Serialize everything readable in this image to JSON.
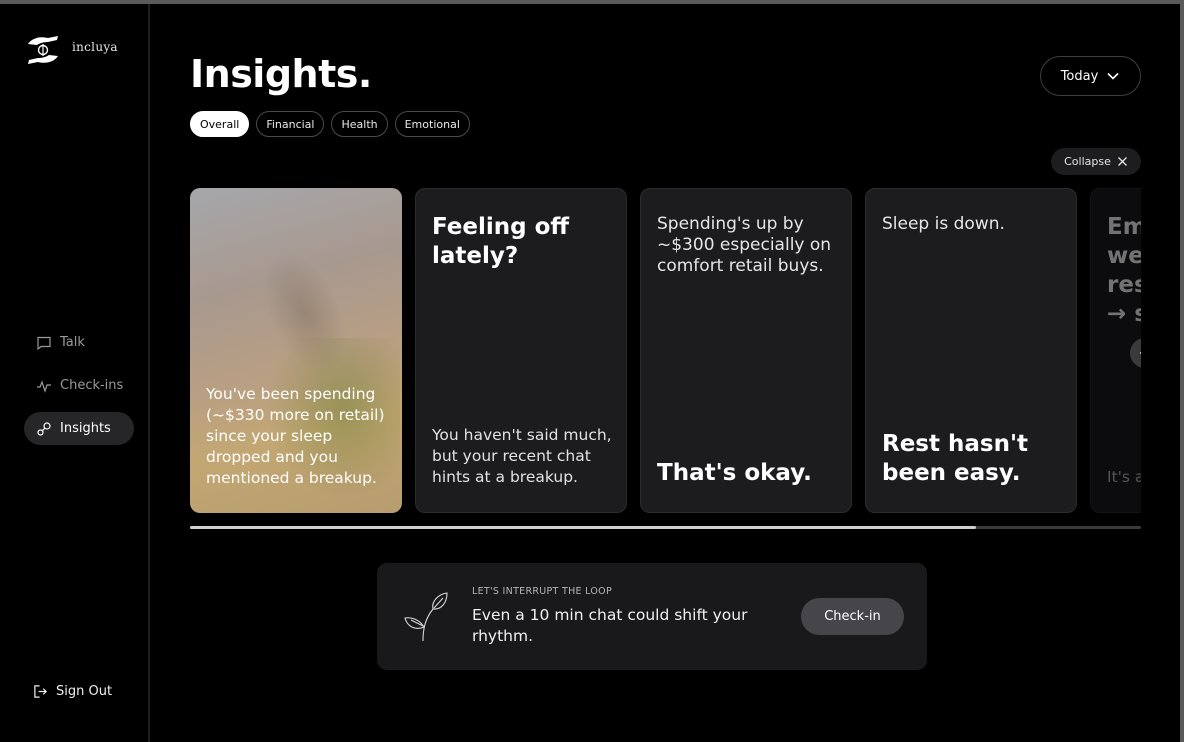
{
  "app": {
    "brand": "incluya"
  },
  "sidebar": {
    "items": [
      {
        "label": "Talk",
        "icon": "chat-icon",
        "active": false
      },
      {
        "label": "Check-ins",
        "icon": "pulse-icon",
        "active": false
      },
      {
        "label": "Insights",
        "icon": "insights-icon",
        "active": true
      }
    ],
    "sign_out": "Sign Out"
  },
  "header": {
    "title": "Insights.",
    "period": "Today"
  },
  "filters": [
    {
      "label": "Overall",
      "active": true
    },
    {
      "label": "Financial",
      "active": false
    },
    {
      "label": "Health",
      "active": false
    },
    {
      "label": "Emotional",
      "active": false
    }
  ],
  "collapse_label": "Collapse",
  "cards": [
    {
      "bottom": "You've been spending (~$330 more on retail) since your sleep dropped and you mentioned a breakup."
    },
    {
      "top": "Feeling off lately?",
      "bottom": "You haven't said much, but your recent chat hints at a breakup."
    },
    {
      "top": "Spending's up by ~$300 especially on comfort retail buys.",
      "bottom": "That's okay."
    },
    {
      "top": "Sleep is down.",
      "bottom": "Rest hasn't been easy."
    },
    {
      "top": "Emo weig restl → sp",
      "bottom": "It's a fa"
    }
  ],
  "carousel_progress": 0.826,
  "promo": {
    "kicker": "LET'S INTERRUPT THE LOOP",
    "text": "Even a 10 min chat could shift your rhythm.",
    "button": "Check-in"
  },
  "colors": {
    "background": "#000000",
    "card": "#1c1c1f",
    "accent_chip": "#ffffff"
  }
}
